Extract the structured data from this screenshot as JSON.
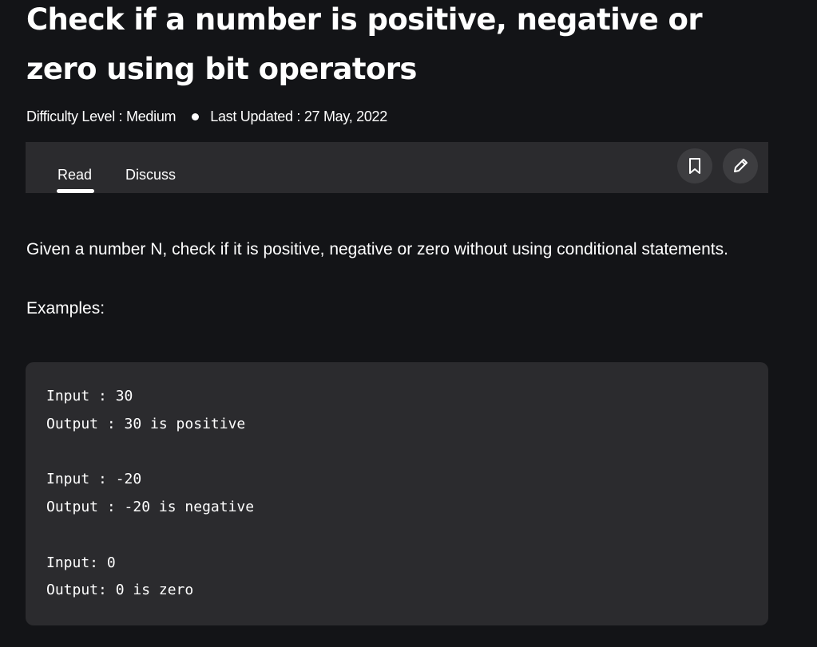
{
  "article": {
    "title": "Check if a number is positive, negative or zero using bit operators",
    "difficulty": "Difficulty Level : Medium",
    "last_updated": "Last Updated : 27 May, 2022"
  },
  "tabs": [
    {
      "label": "Read",
      "active": true
    },
    {
      "label": "Discuss",
      "active": false
    }
  ],
  "actions": {
    "bookmark_icon": "bookmark-icon",
    "edit_icon": "pencil-icon"
  },
  "body": {
    "intro": "Given a number N, check if it is positive, negative or zero without using conditional statements.",
    "examples_label": "Examples:"
  },
  "code": {
    "lines": [
      "Input : 30",
      "Output : 30 is positive",
      "Input : -20",
      "Output : -20 is negative",
      "Input: 0",
      "Output: 0 is zero"
    ]
  },
  "colors": {
    "background": "#131417",
    "panel": "#2b2b2e",
    "icon_button": "#3d3d40",
    "text": "#ffffff"
  }
}
